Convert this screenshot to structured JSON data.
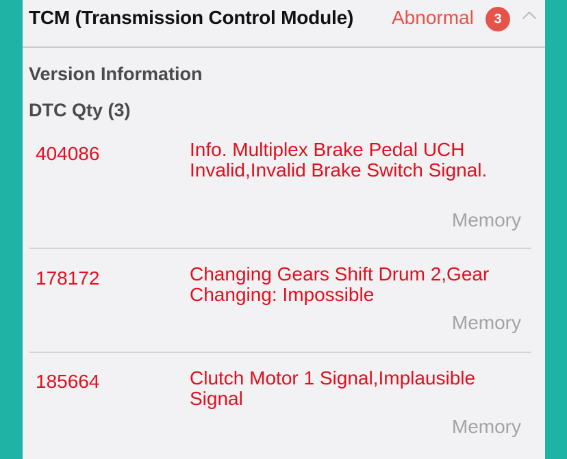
{
  "module": {
    "title": "TCM (Transmission Control Module)",
    "status": "Abnormal",
    "count": "3",
    "status_color": "#e5534b"
  },
  "sections": {
    "version_label": "Version Information",
    "dtc_qty_label": "DTC Qty (3)"
  },
  "dtcs": [
    {
      "code": "404086",
      "description": "Info. Multiplex Brake Pedal UCH Invalid,Invalid Brake Switch Signal.",
      "state": "Memory"
    },
    {
      "code": "178172",
      "description": "Changing Gears Shift Drum 2,Gear Changing: Impossible",
      "state": "Memory"
    },
    {
      "code": "185664",
      "description": "Clutch Motor 1 Signal,Implausible Signal",
      "state": "Memory"
    }
  ],
  "colors": {
    "background": "#1fb3a5",
    "panel": "#f2f2f4",
    "dtc_text": "#e0101e",
    "state_text": "#a3a3a6"
  },
  "icons": {
    "collapse": "chevron-up-icon"
  }
}
